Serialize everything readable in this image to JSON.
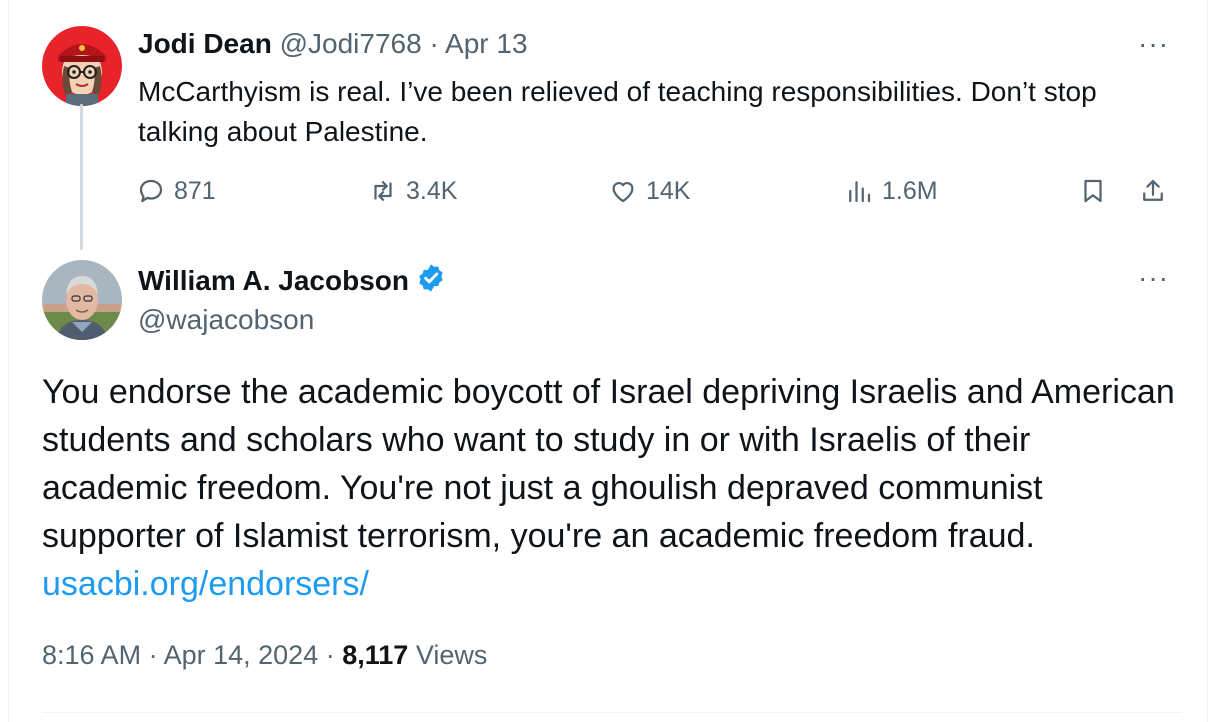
{
  "reply_tweet": {
    "name": "Jodi Dean",
    "handle": "@Jodi7768",
    "separator": "·",
    "date": "Apr 13",
    "text": "McCarthyism is real. I’ve been relieved of teaching responsibilities. Don’t stop talking about Palestine.",
    "actions": {
      "replies": "871",
      "reposts": "3.4K",
      "likes": "14K",
      "views": "1.6M"
    },
    "more": "···"
  },
  "main_tweet": {
    "name": "William A. Jacobson",
    "handle": "@wajacobson",
    "verified": true,
    "more": "···",
    "text": "You endorse the academic boycott of Israel depriving Israelis and American students and scholars who want to study in or with Israelis of their academic freedom. You're not just a ghoulish depraved communist supporter of Islamist terrorism, you're an academic freedom fraud.",
    "link": "usacbi.org/endorsers/",
    "time": "8:16 AM",
    "sep1": "·",
    "date": "Apr 14, 2024",
    "sep2": "·",
    "views_count": "8,117",
    "views_label": "Views"
  },
  "colors": {
    "text": "#0f1419",
    "muted": "#536471",
    "link": "#1d9bf0",
    "verified": "#1d9bf0",
    "divider": "#eff3f4"
  }
}
